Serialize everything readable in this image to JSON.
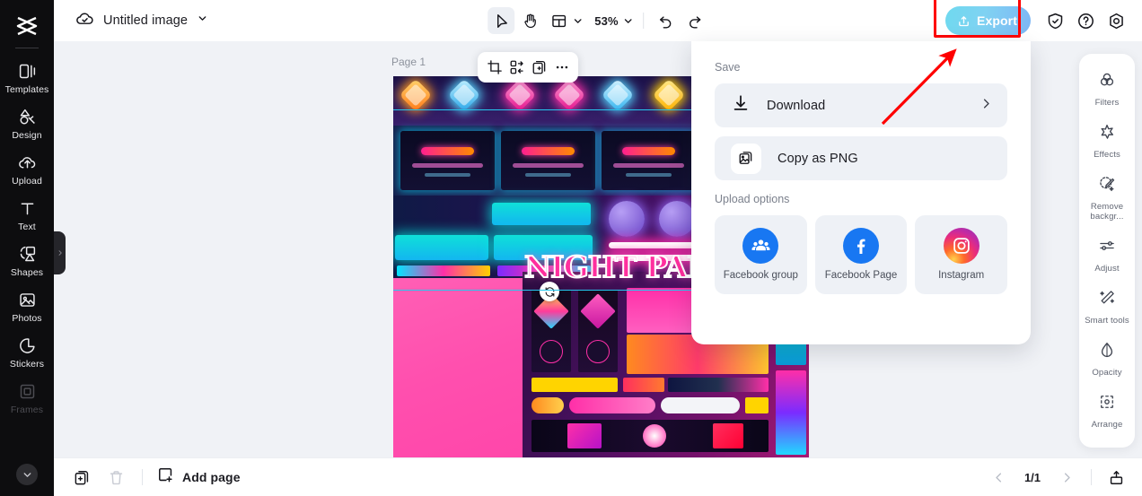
{
  "app": {
    "logo_icon": "capcut-logo-icon"
  },
  "left_sidebar": {
    "items": [
      {
        "label": "Templates",
        "icon": "templates-icon"
      },
      {
        "label": "Design",
        "icon": "design-icon"
      },
      {
        "label": "Upload",
        "icon": "upload-cloud-icon"
      },
      {
        "label": "Text",
        "icon": "text-icon"
      },
      {
        "label": "Shapes",
        "icon": "shapes-icon"
      },
      {
        "label": "Photos",
        "icon": "photos-icon"
      },
      {
        "label": "Stickers",
        "icon": "stickers-icon"
      },
      {
        "label": "Frames",
        "icon": "frames-icon"
      }
    ],
    "collapse_icon": "chevron-down-icon",
    "panel_expand_icon": "chevron-right-icon"
  },
  "topbar": {
    "cloud_status_icon": "cloud-check-icon",
    "title": "Untitled image",
    "title_chevron_icon": "chevron-down-icon",
    "tools": [
      {
        "name": "select-tool",
        "icon": "cursor-icon",
        "active": true
      },
      {
        "name": "hand-tool",
        "icon": "hand-icon",
        "active": false
      },
      {
        "name": "layout-tool",
        "icon": "layout-icon",
        "active": false
      }
    ],
    "zoom_level": "53%",
    "zoom_chevron_icon": "chevron-down-icon",
    "undo_icon": "undo-icon",
    "redo_icon": "redo-icon",
    "export_label": "Export",
    "export_icon": "upload-box-icon",
    "export_gradient_from": "#6fd9ef",
    "export_gradient_to": "#7eb6f5",
    "right_icons": [
      {
        "name": "shield-icon"
      },
      {
        "name": "help-question-icon"
      },
      {
        "name": "settings-gear-icon"
      }
    ],
    "annotation_box_color": "#ff0000"
  },
  "canvas": {
    "page_label": "Page 1",
    "background_color": "#f0f2f6",
    "selection_color": "#25c7ee",
    "rotate_icon": "rotate-icon",
    "poster_title": "NIGHT PART",
    "float_toolbar": [
      {
        "name": "crop-icon"
      },
      {
        "name": "replace-media-icon"
      },
      {
        "name": "duplicate-icon"
      },
      {
        "name": "more-options-icon"
      }
    ]
  },
  "export_menu": {
    "save_label": "Save",
    "rows": [
      {
        "label": "Download",
        "icon": "download-icon",
        "chevron": "chevron-right-icon"
      },
      {
        "label": "Copy as PNG",
        "icon": "copy-image-icon",
        "chevron": ""
      }
    ],
    "upload_options_label": "Upload options",
    "cards": [
      {
        "label": "Facebook group",
        "icon": "facebook-group-icon",
        "color": "#1877f2"
      },
      {
        "label": "Facebook Page",
        "icon": "facebook-page-icon",
        "color": "#1877f2"
      },
      {
        "label": "Instagram",
        "icon": "instagram-icon",
        "color": "#c32aa3"
      }
    ]
  },
  "right_sidebar": {
    "items": [
      {
        "label": "Filters",
        "icon": "filters-icon"
      },
      {
        "label": "Effects",
        "icon": "effects-icon"
      },
      {
        "label": "Remove backgr...",
        "icon": "remove-background-icon"
      },
      {
        "label": "Adjust",
        "icon": "adjust-icon"
      },
      {
        "label": "Smart tools",
        "icon": "smart-tools-icon"
      },
      {
        "label": "Opacity",
        "icon": "opacity-icon"
      },
      {
        "label": "Arrange",
        "icon": "arrange-icon"
      }
    ]
  },
  "bottombar": {
    "duplicate_icon": "duplicate-page-icon",
    "delete_icon": "trash-icon",
    "add_page_label": "Add page",
    "add_page_icon": "add-page-icon",
    "prev_icon": "chevron-left-icon",
    "next_icon": "chevron-right-icon",
    "page_indicator": "1/1",
    "export_icon": "share-export-icon"
  }
}
